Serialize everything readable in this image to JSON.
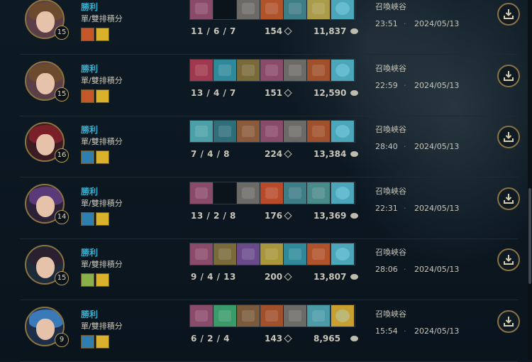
{
  "matches": [
    {
      "result": "勝利",
      "queue": "單/雙排積分",
      "level": "15",
      "kda": "11 / 6 / 7",
      "cs": "154",
      "gold": "11,837",
      "map": "召喚峽谷",
      "duration": "23:51",
      "date": "2024/05/13",
      "avatar": {
        "hair": "#6b4a2e",
        "bg": "#5a3e48"
      },
      "spells": [
        "#c4562a",
        "#d9b12a"
      ],
      "items": [
        "#8a4a6a",
        "",
        "#6b6a66",
        "#b0522a",
        "#3d7d86",
        "#a99b4a",
        "#4aa6b8"
      ]
    },
    {
      "result": "勝利",
      "queue": "單/雙排積分",
      "level": "15",
      "kda": "13 / 4 / 7",
      "cs": "151",
      "gold": "12,590",
      "map": "召喚峽谷",
      "duration": "22:59",
      "date": "2024/05/13",
      "avatar": {
        "hair": "#6b4a2e",
        "bg": "#5a3e48"
      },
      "spells": [
        "#c4562a",
        "#d9b12a"
      ],
      "items": [
        "#a0384e",
        "#2e8a9a",
        "#7a6a3a",
        "#8a4a6a",
        "#6b6a66",
        "#a0502a",
        "#4aa6b8"
      ]
    },
    {
      "result": "勝利",
      "queue": "單/雙排積分",
      "level": "16",
      "kda": "7 / 4 / 8",
      "cs": "224",
      "gold": "13,384",
      "map": "召喚峽谷",
      "duration": "28:40",
      "date": "2024/05/13",
      "avatar": {
        "hair": "#7a2028",
        "bg": "#3a1c22"
      },
      "spells": [
        "#2e7fb0",
        "#d9b12a"
      ],
      "items": [
        "#4aa0a6",
        "#2e6e7a",
        "#8a5a3a",
        "#8a4a6a",
        "#6b6a66",
        "#a0502a",
        "#4aa6b8"
      ]
    },
    {
      "result": "勝利",
      "queue": "單/雙排積分",
      "level": "14",
      "kda": "13 / 2 / 8",
      "cs": "176",
      "gold": "13,369",
      "map": "召喚峽谷",
      "duration": "22:31",
      "date": "2024/05/13",
      "avatar": {
        "hair": "#5a3a78",
        "bg": "#2c2238"
      },
      "spells": [
        "#2e7fb0",
        "#d9b12a"
      ],
      "items": [
        "#8a4a6a",
        "",
        "#6b6a66",
        "#b84a2a",
        "#3d7d86",
        "#4a8a8a",
        "#4aa6b8"
      ]
    },
    {
      "result": "勝利",
      "queue": "單/雙排積分",
      "level": "15",
      "kda": "9 / 4 / 13",
      "cs": "200",
      "gold": "13,807",
      "map": "召喚峽谷",
      "duration": "28:06",
      "date": "2024/05/13",
      "avatar": {
        "hair": "#2a2030",
        "bg": "#1c2a3a"
      },
      "spells": [
        "#8ab04a",
        "#d9b12a"
      ],
      "items": [
        "#8a4a6a",
        "#7a6a3a",
        "#6a4a8a",
        "#a9953a",
        "#2e8a9a",
        "#b0522a",
        "#4aa6b8"
      ]
    },
    {
      "result": "勝利",
      "queue": "單/雙排積分",
      "level": "9",
      "kda": "6 / 2 / 4",
      "cs": "143",
      "gold": "8,965",
      "map": "召喚峽谷",
      "duration": "15:54",
      "date": "2024/05/13",
      "avatar": {
        "hair": "#3a7ab8",
        "bg": "#1c2e48"
      },
      "spells": [
        "#2e7fb0",
        "#d9b12a"
      ],
      "items": [
        "#8a4a6a",
        "#3a9a6a",
        "#7a5a3a",
        "#a0502a",
        "#6b6a66",
        "#4a9aa8",
        "#c9a030"
      ]
    }
  ]
}
